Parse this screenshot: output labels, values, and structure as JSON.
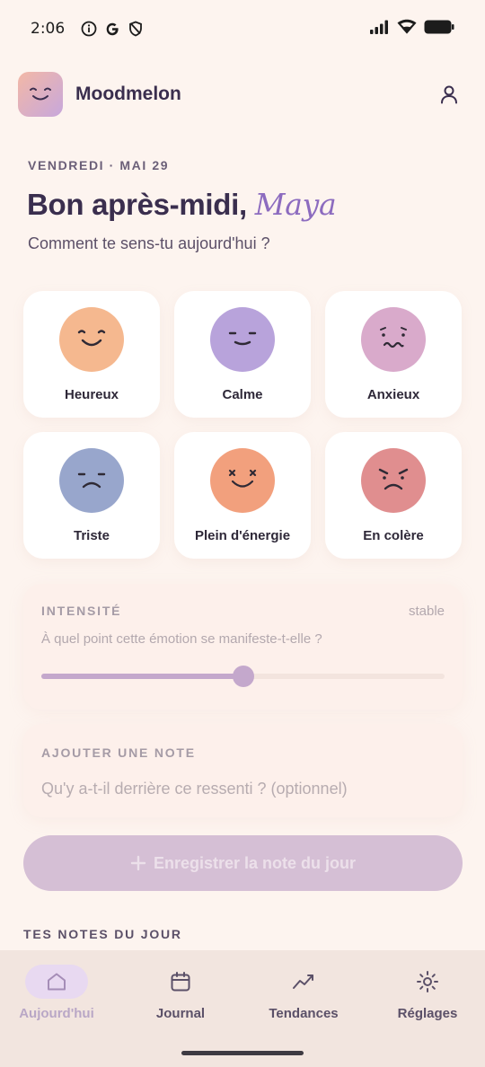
{
  "status_bar": {
    "time": "2:06",
    "icons_left": [
      "info-icon",
      "google-icon",
      "shield-icon"
    ],
    "icons_right": [
      "signal-icon",
      "wifi-icon",
      "battery-icon"
    ]
  },
  "app": {
    "name": "Moodmelon",
    "logo_icon": "smiling-face-icon",
    "profile_icon": "user-icon"
  },
  "header": {
    "date": "VENDREDI · MAI 29",
    "greeting_prefix": "Bon après-midi,",
    "user_name": "Maya",
    "question": "Comment te sens-tu aujourd'hui ?"
  },
  "moods": [
    {
      "label": "Heureux",
      "color": "#f5b88f",
      "icon": "happy-face-icon"
    },
    {
      "label": "Calme",
      "color": "#b8a3db",
      "icon": "calm-face-icon"
    },
    {
      "label": "Anxieux",
      "color": "#d9aacb",
      "icon": "anxious-face-icon"
    },
    {
      "label": "Triste",
      "color": "#98a6cc",
      "icon": "sad-face-icon"
    },
    {
      "label": "Plein d'énergie",
      "color": "#f2a07d",
      "icon": "energetic-face-icon"
    },
    {
      "label": "En colère",
      "color": "#e08e8f",
      "icon": "angry-face-icon"
    }
  ],
  "intensity": {
    "title": "INTENSITÉ",
    "status": "stable",
    "question": "À quel point cette émotion se manifeste-t-elle ?",
    "value_fraction": 0.5
  },
  "note": {
    "title": "AJOUTER UNE NOTE",
    "placeholder": "Qu'y a-t-il derrière ce ressenti ? (optionnel)"
  },
  "save_button": {
    "label": "Enregistrer la note du jour",
    "icon": "plus-icon"
  },
  "notes_section": {
    "title": "TES NOTES DU JOUR"
  },
  "nav": {
    "items": [
      {
        "label": "Aujourd'hui",
        "icon": "home-icon",
        "active": true
      },
      {
        "label": "Journal",
        "icon": "calendar-icon",
        "active": false
      },
      {
        "label": "Tendances",
        "icon": "trend-icon",
        "active": false
      },
      {
        "label": "Réglages",
        "icon": "sun-gear-icon",
        "active": false
      }
    ]
  },
  "colors": {
    "background": "#fdf4ef",
    "accent": "#8c6bbf",
    "slider": "#c4a8cc",
    "button": "#d5bfd5"
  }
}
